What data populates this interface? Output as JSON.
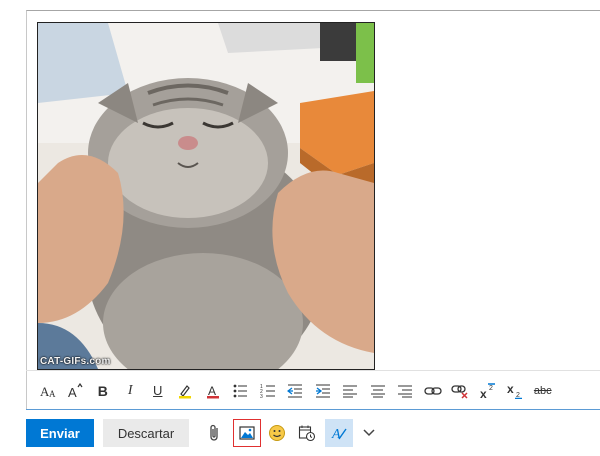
{
  "image": {
    "watermark": "CAT-GIFs.com",
    "alt_icon": "inline-cat-gif"
  },
  "format_toolbar": {
    "items": [
      {
        "name": "font-size-icon"
      },
      {
        "name": "grow-font-icon"
      },
      {
        "name": "bold-icon",
        "glyph": "B"
      },
      {
        "name": "italic-icon",
        "glyph": "I"
      },
      {
        "name": "underline-icon",
        "glyph": "U"
      },
      {
        "name": "highlight-icon"
      },
      {
        "name": "font-color-icon",
        "glyph": "A"
      },
      {
        "name": "bullets-icon"
      },
      {
        "name": "numbering-icon"
      },
      {
        "name": "decrease-indent-icon"
      },
      {
        "name": "increase-indent-icon"
      },
      {
        "name": "align-left-icon"
      },
      {
        "name": "align-center-icon"
      },
      {
        "name": "align-right-icon"
      },
      {
        "name": "insert-link-icon"
      },
      {
        "name": "remove-link-icon"
      },
      {
        "name": "superscript-icon"
      },
      {
        "name": "subscript-icon"
      },
      {
        "name": "strikethrough-icon",
        "glyph": "abc"
      }
    ],
    "accent_color": "#0078d4",
    "red_color": "#d13438"
  },
  "actions": {
    "send_label": "Enviar",
    "discard_label": "Descartar",
    "icons": [
      "attach-icon",
      "insert-picture-icon",
      "emoji-icon",
      "schedule-send-icon",
      "format-text-icon",
      "chevron-down-icon"
    ]
  }
}
